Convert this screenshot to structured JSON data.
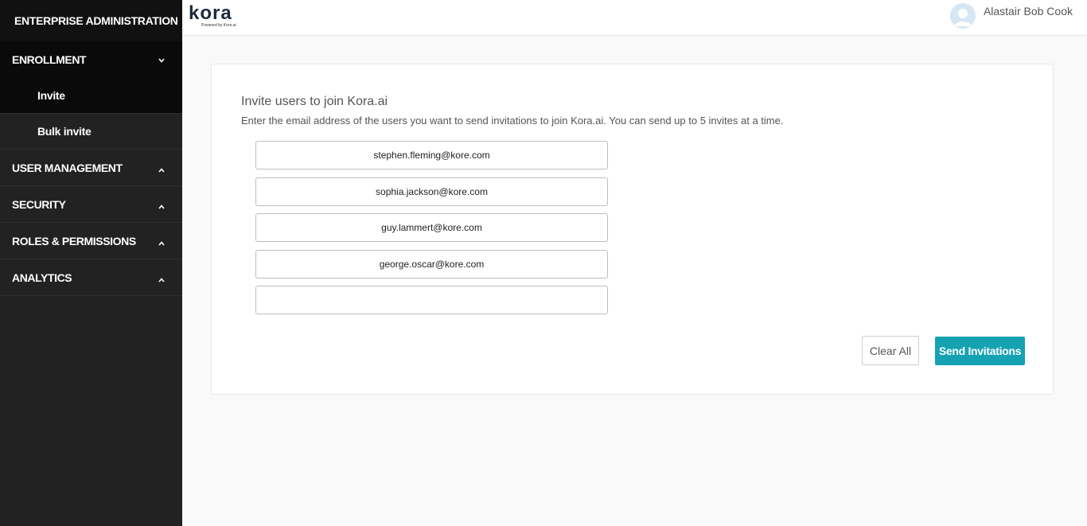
{
  "sidebar": {
    "title": "ENTERPRISE ADMINISTRATION",
    "sections": [
      {
        "label": "ENROLLMENT",
        "expanded": true
      },
      {
        "label": "USER MANAGEMENT",
        "expanded": false
      },
      {
        "label": "SECURITY",
        "expanded": false
      },
      {
        "label": "ROLES & PERMISSIONS",
        "expanded": false
      },
      {
        "label": "ANALYTICS",
        "expanded": false
      }
    ],
    "enrollment_items": [
      {
        "label": "Invite",
        "active": true
      },
      {
        "label": "Bulk invite",
        "active": false
      }
    ]
  },
  "header": {
    "logo_text": "kora",
    "logo_tagline": "Powered by Kore.ai",
    "user_name": "Alastair Bob Cook"
  },
  "invite": {
    "title": "Invite users to join Kora.ai",
    "description": "Enter the email address of the users you want to send invitations to join Kora.ai. You can send up to 5 invites at a time.",
    "emails": [
      "stephen.fleming@kore.com",
      "sophia.jackson@kore.com",
      "guy.lammert@kore.com",
      "george.oscar@kore.com",
      ""
    ],
    "clear_label": "Clear All",
    "send_label": "Send Invitations"
  },
  "colors": {
    "sidebar_bg": "#222222",
    "sidebar_active": "#0a0a0a",
    "accent": "#15a3b3"
  }
}
